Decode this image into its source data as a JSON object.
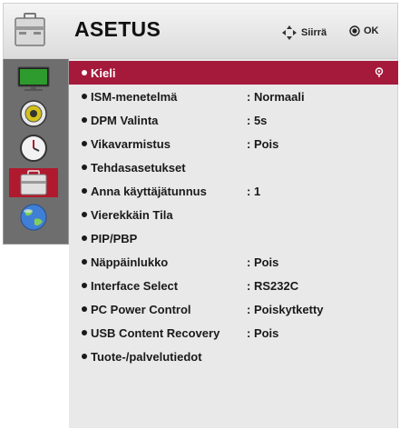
{
  "header": {
    "title": "ASETUS",
    "hint_move_label": "Siirrä",
    "hint_ok_label": "OK",
    "icon": "toolbox-icon"
  },
  "sidebar": {
    "items": [
      {
        "icon": "monitor-picture-icon",
        "selected": false
      },
      {
        "icon": "speaker-sound-icon",
        "selected": false
      },
      {
        "icon": "clock-time-icon",
        "selected": false
      },
      {
        "icon": "toolbox-setup-icon",
        "selected": true
      },
      {
        "icon": "globe-network-icon",
        "selected": false
      }
    ]
  },
  "menu": {
    "items": [
      {
        "label": "Kieli",
        "value": "",
        "selected": true
      },
      {
        "label": "ISM-menetelmä",
        "value": ": Normaali",
        "selected": false
      },
      {
        "label": "DPM Valinta",
        "value": ": 5s",
        "selected": false
      },
      {
        "label": "Vikavarmistus",
        "value": ": Pois",
        "selected": false
      },
      {
        "label": "Tehdasasetukset",
        "value": "",
        "selected": false
      },
      {
        "label": "Anna käyttäjätunnus",
        "value": ": 1",
        "selected": false
      },
      {
        "label": "Vierekkäin Tila",
        "value": "",
        "selected": false
      },
      {
        "label": "PIP/PBP",
        "value": "",
        "selected": false
      },
      {
        "label": "Näppäinlukko",
        "value": ": Pois",
        "selected": false
      },
      {
        "label": "Interface Select",
        "value": ": RS232C",
        "selected": false
      },
      {
        "label": "PC Power Control",
        "value": ": Poiskytketty",
        "selected": false
      },
      {
        "label": "USB Content Recovery",
        "value": ": Pois",
        "selected": false
      },
      {
        "label": "Tuote-/palvelutiedot",
        "value": "",
        "selected": false
      }
    ]
  },
  "colors": {
    "accent": "#a51a3b",
    "sidebar_bg": "#6e6e6e",
    "content_bg": "#e9e9e9"
  }
}
